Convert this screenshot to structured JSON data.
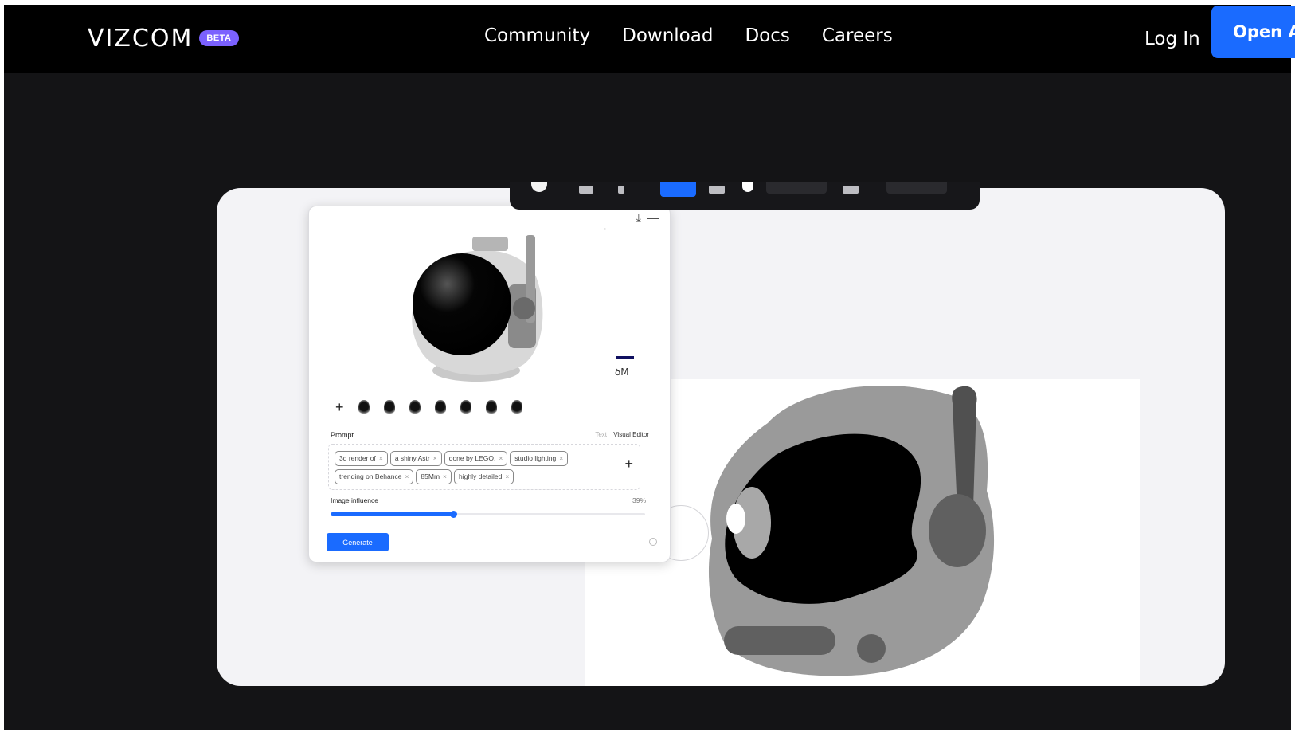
{
  "nav": {
    "logo": "VIZCOM",
    "badge": "BETA",
    "links": [
      "Community",
      "Download",
      "Docs",
      "Careers"
    ],
    "login": "Log In",
    "cta": "Open Ap"
  },
  "panel": {
    "preview_label": "ꝺM",
    "prompt_label": "Prompt",
    "mode_text": "Text",
    "mode_visual": "Visual Editor",
    "chips": [
      "3d render of",
      "a shiny Astr",
      "done by LEGO,",
      "studio lighting",
      "trending on Behance",
      "85Mm",
      "highly detailed"
    ],
    "influence_label": "Image influence",
    "influence_value": "39%",
    "influence": 0.39,
    "generate": "Generate"
  },
  "colors": {
    "accent": "#1a6bff",
    "beta": "#7b61ff",
    "nav_bg": "#000000",
    "page_bg": "#141416"
  },
  "icons": [
    "download-icon",
    "minimize-icon",
    "plus-icon",
    "close-icon",
    "help-icon"
  ]
}
